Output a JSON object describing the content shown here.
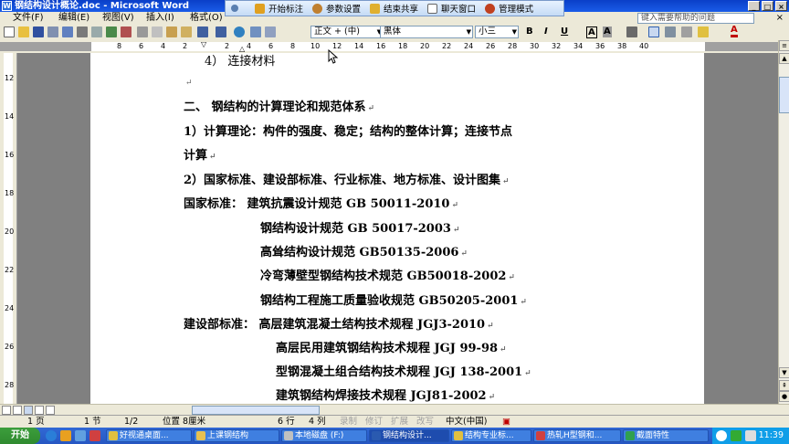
{
  "window": {
    "title": "钢结构设计概论.doc - Microsoft Word"
  },
  "menu": {
    "items": [
      "文件(F)",
      "编辑(E)",
      "视图(V)",
      "插入(I)",
      "格式(O)"
    ],
    "help_placeholder": "键入需要帮助的问题",
    "close_glyph": "×"
  },
  "remote_toolbar": {
    "buttons": [
      "开始标注",
      "参数设置",
      "结束共享",
      "聊天窗口",
      "管理模式"
    ]
  },
  "toolbar": {
    "style": "正文 + (中)",
    "font": "黑体",
    "size": "小三",
    "bold": "B",
    "italic": "I",
    "underline": "U",
    "char_border": "A",
    "char_shade": "A",
    "font_color": "A"
  },
  "ruler": {
    "numbers": [
      "2",
      "4",
      "6",
      "8",
      "10",
      "12",
      "14",
      "16",
      "18",
      "20",
      "22",
      "24",
      "26",
      "28",
      "30",
      "32",
      "34",
      "36",
      "38",
      "40"
    ],
    "left_numbers": [
      "8",
      "6",
      "4",
      "2"
    ],
    "vertical_numbers": [
      "12",
      "14",
      "16",
      "18",
      "20",
      "22",
      "24",
      "26",
      "28"
    ]
  },
  "document": {
    "lines": [
      "4）  连接材料",
      "二、  钢结构的计算理论和规范体系",
      "1）计算理论：构件的强度、稳定；结构的整体计算；连接节点",
      "计算",
      "2）国家标准、建设部标准、行业标准、地方标准、设计图集",
      "国家标准：  建筑抗震设计规范 GB 50011-2010",
      "钢结构设计规范 GB 50017-2003",
      "高耸结构设计规范 GB50135-2006",
      "冷弯薄壁型钢结构技术规范 GB50018-2002",
      "钢结构工程施工质量验收规范 GB50205-2001",
      "建设部标准：  高层建筑混凝土结构技术规程 JGJ3-2010",
      "高层民用建筑钢结构技术规程 JGJ 99-98",
      "型钢混凝土组合结构技术规程 JGJ 138-2001",
      "建筑钢结构焊接技术规程  JGJ81-2002"
    ],
    "paragraph_mark": "↵"
  },
  "status": {
    "page": "1 页",
    "section": "1 节",
    "page_of": "1/2",
    "position": "位置 8厘米",
    "line": "6 行",
    "column": "4 列",
    "rec": "录制",
    "trk": "修订",
    "ext": "扩展",
    "ovr": "改写",
    "language": "中文(中国)"
  },
  "taskbar": {
    "start": "开始",
    "tasks": [
      "好视通桌面...",
      "上课钢结构",
      "本地磁盘 (F:)",
      "钢结构设计...",
      "结构专业标...",
      "热轧H型钢和...",
      "截面特性"
    ],
    "clock": "11:39"
  }
}
